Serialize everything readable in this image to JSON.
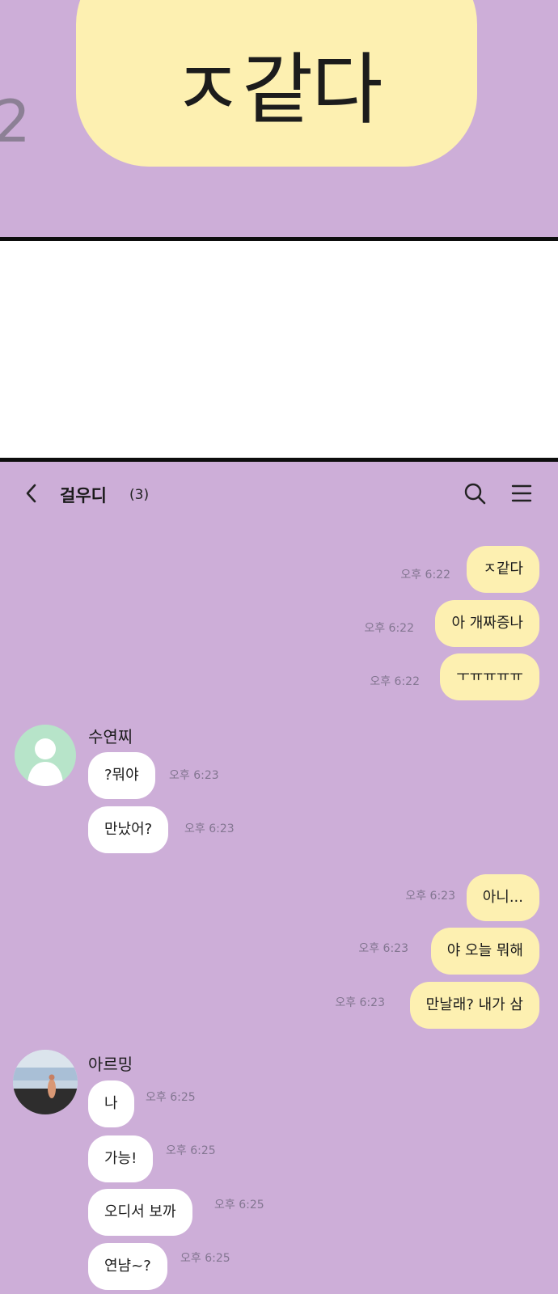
{
  "zoom": {
    "bubble_text": "ㅈ같다",
    "partial_time": "2"
  },
  "header": {
    "title": "걸우디",
    "member_count": "(3)"
  },
  "messages": [
    {
      "text": "ㅈ같다",
      "time": "오후 6:22"
    },
    {
      "text": "아 개짜증나",
      "time": "오후 6:22"
    },
    {
      "text": "ㅜㅠㅠㅠㅠ",
      "time": "오후 6:22"
    },
    {
      "sender": "수연찌",
      "text": "?뭐야",
      "time": "오후 6:23"
    },
    {
      "text": "만났어?",
      "time": "오후 6:23"
    },
    {
      "text": "아니...",
      "time": "오후 6:23"
    },
    {
      "text": "야 오늘 뭐해",
      "time": "오후 6:23"
    },
    {
      "text": "만날래? 내가 삼",
      "time": "오후 6:23"
    },
    {
      "sender": "아르밍",
      "text": "나",
      "time": "오후 6:25"
    },
    {
      "text": "가능!",
      "time": "오후 6:25"
    },
    {
      "text": "오디서 보까",
      "time": "오후 6:25"
    },
    {
      "text": "연냠~?",
      "time": "오후 6:25"
    }
  ],
  "colors": {
    "chat_background": "#cdaed8",
    "my_bubble": "#fdf0b1",
    "other_bubble": "#ffffff",
    "timestamp": "#837691"
  }
}
